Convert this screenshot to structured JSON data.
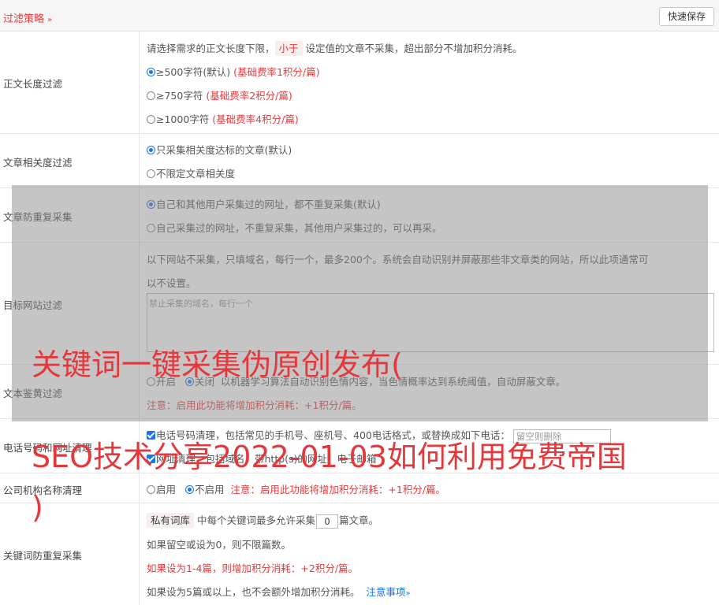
{
  "header": {
    "title": "过滤策略",
    "chevron": "»",
    "save_label": "快速保存"
  },
  "length_filter": {
    "label": "正文长度过滤",
    "hint_before": "请选择需求的正文长度下限，",
    "hint_tag": "小于",
    "hint_after": "设定值的文章不采集，超出部分不增加积分消耗。",
    "options": [
      {
        "text": "≥500字符(默认)",
        "note": "(基础费率1积分/篇)",
        "selected": true
      },
      {
        "text": "≥750字符",
        "note": "(基础费率2积分/篇)",
        "selected": false
      },
      {
        "text": "≥1000字符",
        "note": "(基础费率4积分/篇)",
        "selected": false
      }
    ]
  },
  "relevance_filter": {
    "label": "文章相关度过滤",
    "options": [
      {
        "text": "只采集相关度达标的文章(默认)",
        "selected": true
      },
      {
        "text": "不限定文章相关度",
        "selected": false
      }
    ]
  },
  "dedup_filter": {
    "label": "文章防重复采集",
    "options": [
      {
        "text": "自己和其他用户采集过的网址，都不重复采集(默认)",
        "selected": true
      },
      {
        "text": "自己采集过的网址，不重复采集，其他用户采集过的，可以再采。",
        "selected": false
      }
    ]
  },
  "site_filter": {
    "label": "目标网站过滤",
    "hint_line1": "以下网站不采集，只填域名，每行一个，最多200个。系统会自动识别并屏蔽那些非文章类的网站，所以此项通常可",
    "hint_line2": "以不设置。",
    "textarea_placeholder": "禁止采集的域名，每行一个"
  },
  "porn_filter": {
    "label": "文本鉴黄过滤",
    "on_label": "开启",
    "off_label": "关闭",
    "selected": "off",
    "desc": "以机器学习算法自动识别色情内容，当色情概率达到系统阈值，自动屏蔽文章。",
    "note": "注意：启用此功能将增加积分消耗：+1积分/篇。"
  },
  "phone_filter": {
    "label": "电话号码和网址清理",
    "phone_text": "电话号码清理，包括常见的手机号、座机号、400电话格式，或替换成如下电话：",
    "phone_placeholder": "留空则删除",
    "url_text": "网址清理，包括域名、带http(s)的网址、电子邮箱"
  },
  "org_filter": {
    "label": "公司机构名称清理",
    "on_label": "启用",
    "off_label": "不启用",
    "selected": "off",
    "note": "注意：启用此功能将增加积分消耗：+1积分/篇。"
  },
  "keyword_dedup": {
    "label": "关键词防重复采集",
    "tag": "私有词库",
    "line1_mid": "中每个关键词最多允许采集",
    "count": "0",
    "line1_end": "篇文章。",
    "line2": "如果留空或设为0，则不限篇数。",
    "line3": "如果设为1-4篇，则增加积分消耗：+2积分/篇。",
    "line4": "如果设为5篇或以上，也不会额外增加积分消耗。",
    "link": "注意事项",
    "link_chevron": "»"
  },
  "watermark": {
    "line1": "关键词一键采集伪原创发布(",
    "line2": "SEO技术分享2022-01-03如何利用免费帝国",
    "line3": ")"
  },
  "colors": {
    "accent_red": "#e4393c",
    "radio_blue": "#1a73e8",
    "overlay": "rgba(140,140,140,0.5)"
  }
}
